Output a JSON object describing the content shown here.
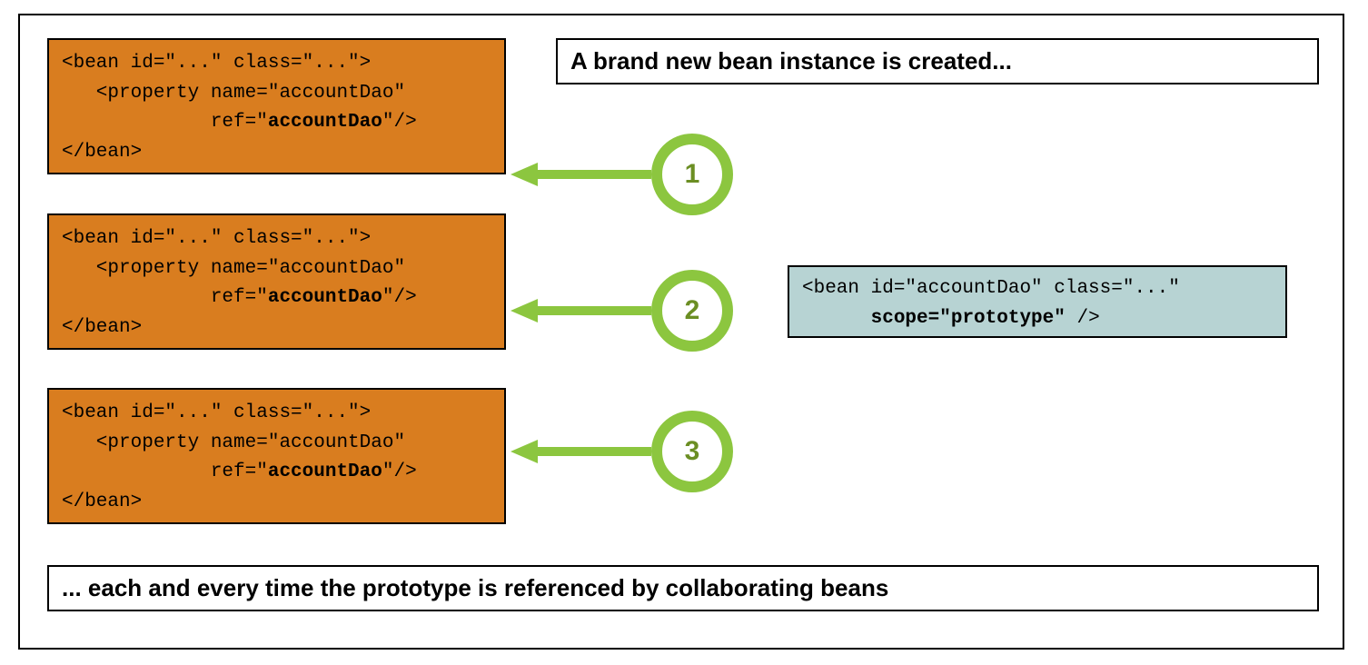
{
  "headline_top": "A brand new bean instance is created...",
  "headline_bottom": "... each and every time the prototype is referenced by collaborating beans",
  "bean_line1": "<bean id=\"...\" class=\"...\">",
  "bean_line2_a": "   <property name=\"accountDao\"",
  "bean_line3_a": "             ref=\"",
  "bean_line3_bold": "accountDao",
  "bean_line3_b": "\"/>",
  "bean_line4": "</bean>",
  "proto_line1": "<bean id=\"accountDao\" class=\"...\"",
  "proto_line2_a": "      ",
  "proto_line2_bold": "scope=\"prototype\"",
  "proto_line2_b": " />",
  "badge1": "1",
  "badge2": "2",
  "badge3": "3"
}
